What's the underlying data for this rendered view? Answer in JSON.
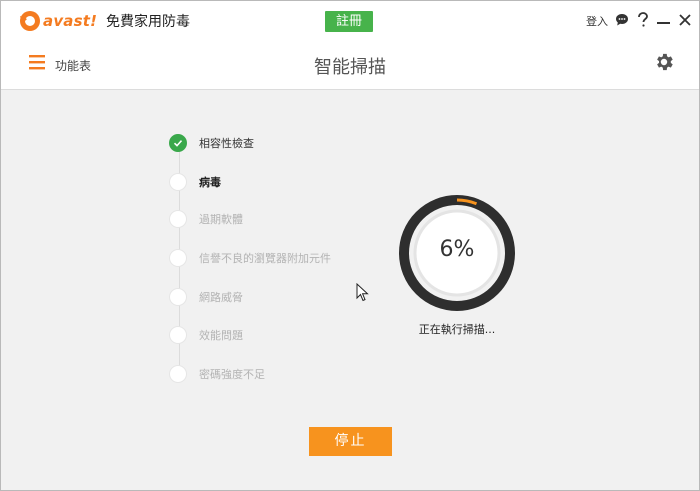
{
  "titlebar": {
    "brand": "avast!",
    "app_name": "免費家用防毒",
    "register_label": "註冊",
    "login_label": "登入",
    "icons": [
      "chat-icon",
      "help-icon",
      "minimize-icon",
      "close-icon"
    ]
  },
  "header": {
    "menu_label": "功能表",
    "title": "智能掃描"
  },
  "scan": {
    "steps": [
      {
        "label": "相容性檢查",
        "state": "done"
      },
      {
        "label": "病毒",
        "state": "active"
      },
      {
        "label": "過期軟體",
        "state": "pending"
      },
      {
        "label": "信譽不良的瀏覽器附加元件",
        "state": "pending"
      },
      {
        "label": "網路威脅",
        "state": "pending"
      },
      {
        "label": "效能問題",
        "state": "pending"
      },
      {
        "label": "密碼強度不足",
        "state": "pending"
      }
    ],
    "progress_percent": 6,
    "progress_text": "6%",
    "status": "正在執行掃描..."
  },
  "actions": {
    "stop_label": "停止"
  },
  "colors": {
    "brand_orange": "#f47b20",
    "register_green": "#47b34b",
    "done_green": "#3aa84b",
    "stop_orange": "#f7931e",
    "progress_orange": "#f7931e"
  }
}
